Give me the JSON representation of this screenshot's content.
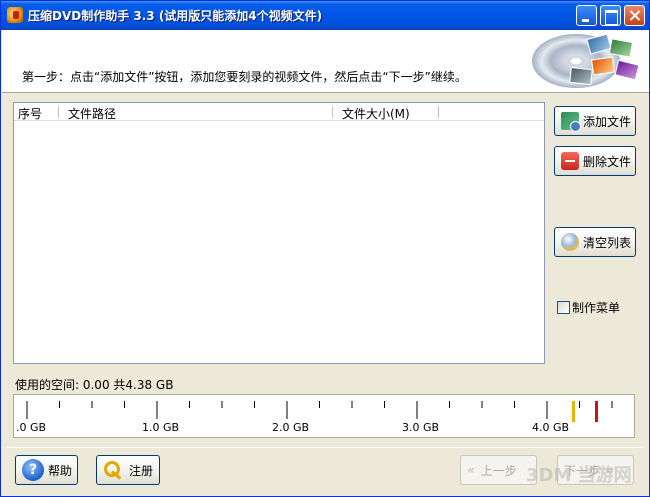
{
  "window": {
    "title": "压缩DVD制作助手 3.3 (试用版只能添加4个视频文件)"
  },
  "header": {
    "step_text": "第一步：点击“添加文件”按钮，添加您要刻录的视频文件，然后点击“下一步”继续。"
  },
  "list": {
    "columns": [
      "序号",
      "文件路径",
      "文件大小(M)"
    ],
    "rows": []
  },
  "side_buttons": {
    "add_label": "添加文件",
    "delete_label": "删除文件",
    "clear_label": "清空列表"
  },
  "menu_checkbox": {
    "label": "制作菜单",
    "checked": false
  },
  "usage": {
    "text": "使用的空间: 0.00  共4.38 GB",
    "used_gb": 0.0,
    "total_gb": 4.38
  },
  "gauge": {
    "tick_labels": [
      ".0 GB",
      "1.0 GB",
      "2.0 GB",
      "3.0 GB",
      "4.0 GB"
    ],
    "markers": [
      {
        "color": "#E8B400",
        "value_gb": 4.2
      },
      {
        "color": "#C81414",
        "value_gb": 4.38
      }
    ]
  },
  "bottom_buttons": {
    "help_label": "帮助",
    "register_label": "注册",
    "prev_label": "上一步",
    "next_label": "下一步"
  },
  "watermark": "3DM 当游网"
}
